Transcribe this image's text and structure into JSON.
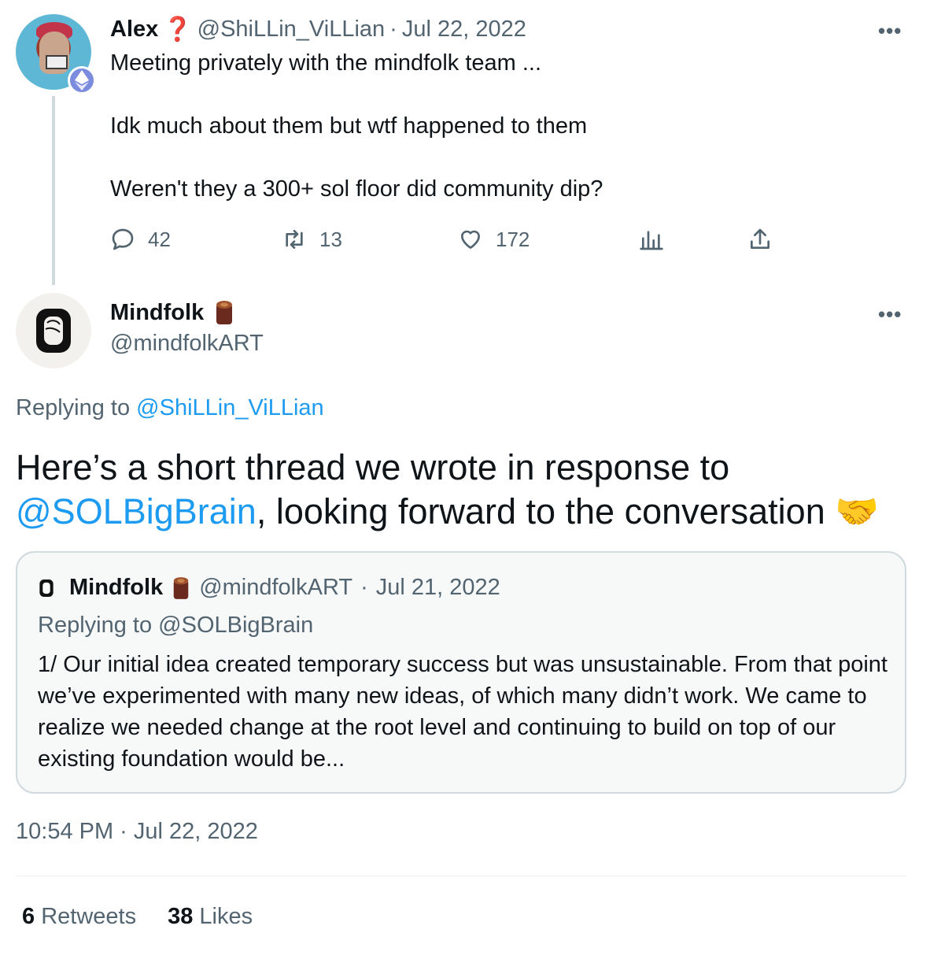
{
  "parent_tweet": {
    "author_name": "Alex",
    "author_emoji": "❓",
    "handle": "@ShiLLin_ViLLian",
    "separator": "·",
    "date": "Jul 22, 2022",
    "more_label": "•••",
    "lines": [
      "Meeting privately with the mindfolk team ...",
      "Idk much about them but wtf happened to them",
      "Weren't they a 300+ sol floor did community dip?"
    ],
    "actions": {
      "replies": "42",
      "retweets": "13",
      "likes": "172"
    }
  },
  "reply_tweet": {
    "author_name": "Mindfolk",
    "handle": "@mindfolkART",
    "more_label": "•••",
    "replying_prefix": "Replying to",
    "replying_to": "@ShiLLin_ViLLian",
    "text_part1": "Here’s a short thread we wrote in response to",
    "mention": "@SOLBigBrain",
    "text_part2": ", looking forward to the conversation",
    "text_emoji": "🤝",
    "timestamp": "10:54 PM · Jul 22, 2022",
    "stats": {
      "retweets_count": "6",
      "retweets_label": "Retweets",
      "likes_count": "38",
      "likes_label": "Likes"
    }
  },
  "quoted_tweet": {
    "author_name": "Mindfolk",
    "handle": "@mindfolkART",
    "separator": "·",
    "date": "Jul 21, 2022",
    "replying_prefix": "Replying to",
    "replying_to": "@SOLBigBrain",
    "body": "1/ Our initial idea created temporary success but was unsustainable. From that point we’ve experimented with many new ideas, of which many didn’t work. We came to realize we needed change at the root level and continuing to build on top of our existing foundation would be..."
  },
  "colors": {
    "link": "#1d9bf0",
    "muted": "#536471",
    "border": "#cfd9de"
  }
}
